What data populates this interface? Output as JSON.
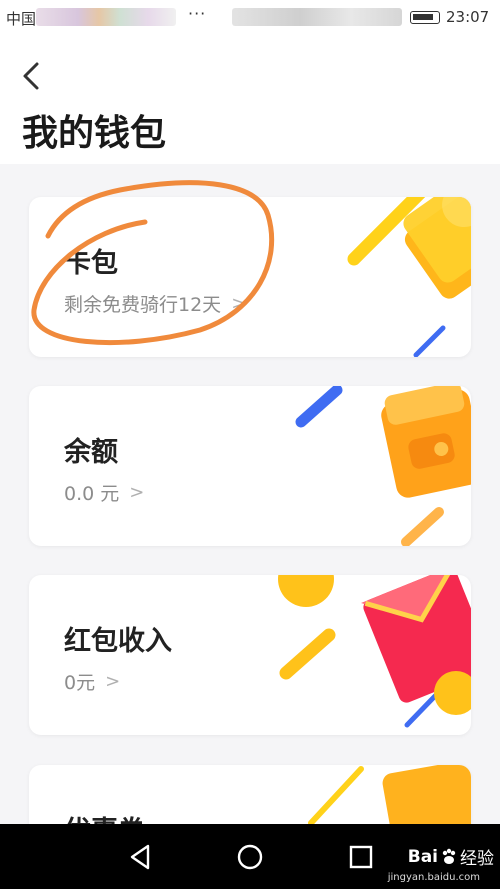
{
  "status_bar": {
    "carrier": "中国",
    "dots": "···",
    "time": "23:07"
  },
  "header": {
    "title": "我的钱包"
  },
  "cards": [
    {
      "title": "卡包",
      "subtitle": "剩余免费骑行12天",
      "icon": "card-pack-icon",
      "accent": "#FFC21A"
    },
    {
      "title": "余额",
      "subtitle": "0.0 元",
      "icon": "wallet-icon",
      "accent": "#FFA41C"
    },
    {
      "title": "红包收入",
      "subtitle": "0元",
      "icon": "red-envelope-icon",
      "accent": "#F5294F"
    },
    {
      "title": "优惠券",
      "subtitle": "",
      "icon": "coupon-icon",
      "accent": "#FFB21E"
    }
  ],
  "annotation": {
    "color": "#F08A3C"
  },
  "nav_bar": {
    "buttons": [
      "back-triangle-icon",
      "home-circle-icon",
      "recents-square-icon"
    ]
  },
  "watermark": {
    "brand": "Bai",
    "brand_suffix": "经验",
    "url": "jingyan.baidu.com"
  }
}
